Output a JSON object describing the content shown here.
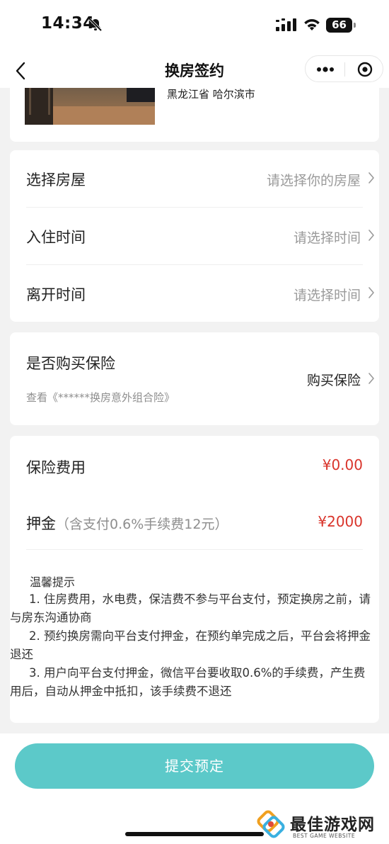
{
  "status_bar": {
    "time": "14:34",
    "battery": "66",
    "icons": [
      "bell-slash-icon",
      "signal-icon",
      "wifi-icon",
      "battery-icon"
    ]
  },
  "nav": {
    "title": "换房签约",
    "back_icon": "chevron-left-icon",
    "more_icon": "more-dots-icon",
    "close_icon": "target-circle-icon"
  },
  "room": {
    "location": "黑龙江省 哈尔滨市"
  },
  "form": {
    "rows": [
      {
        "label": "选择房屋",
        "value": "请选择你的房屋"
      },
      {
        "label": "入住时间",
        "value": "请选择时间"
      },
      {
        "label": "离开时间",
        "value": "请选择时间"
      }
    ]
  },
  "insurance": {
    "title": "是否购买保险",
    "link": "查看《******换房意外组合险》",
    "value": "购买保险"
  },
  "fees": {
    "insurance_label": "保险费用",
    "insurance_amount": "¥0.00",
    "deposit_label": "押金",
    "deposit_note": "（含支付0.6%手续费12元）",
    "deposit_amount": "¥2000",
    "amount_color": "#d9342b"
  },
  "notice": {
    "title": "温馨提示",
    "items": [
      "1. 住房费用，水电费，保洁费不参与平台支付，预定换房之前，请与房东沟通协商",
      "2. 预约换房需向平台支付押金，在预约单完成之后，平台会将押金退还",
      "3. 用户向平台支付押金，微信平台要收取0.6%的手续费，产生费用后，自动从押金中抵扣，该手续费不退还"
    ]
  },
  "submit": {
    "label": "提交预定",
    "color": "#5cc9c9"
  },
  "watermark": {
    "text": "最佳游戏网",
    "sub": "BEST GAME WEBSITE"
  }
}
